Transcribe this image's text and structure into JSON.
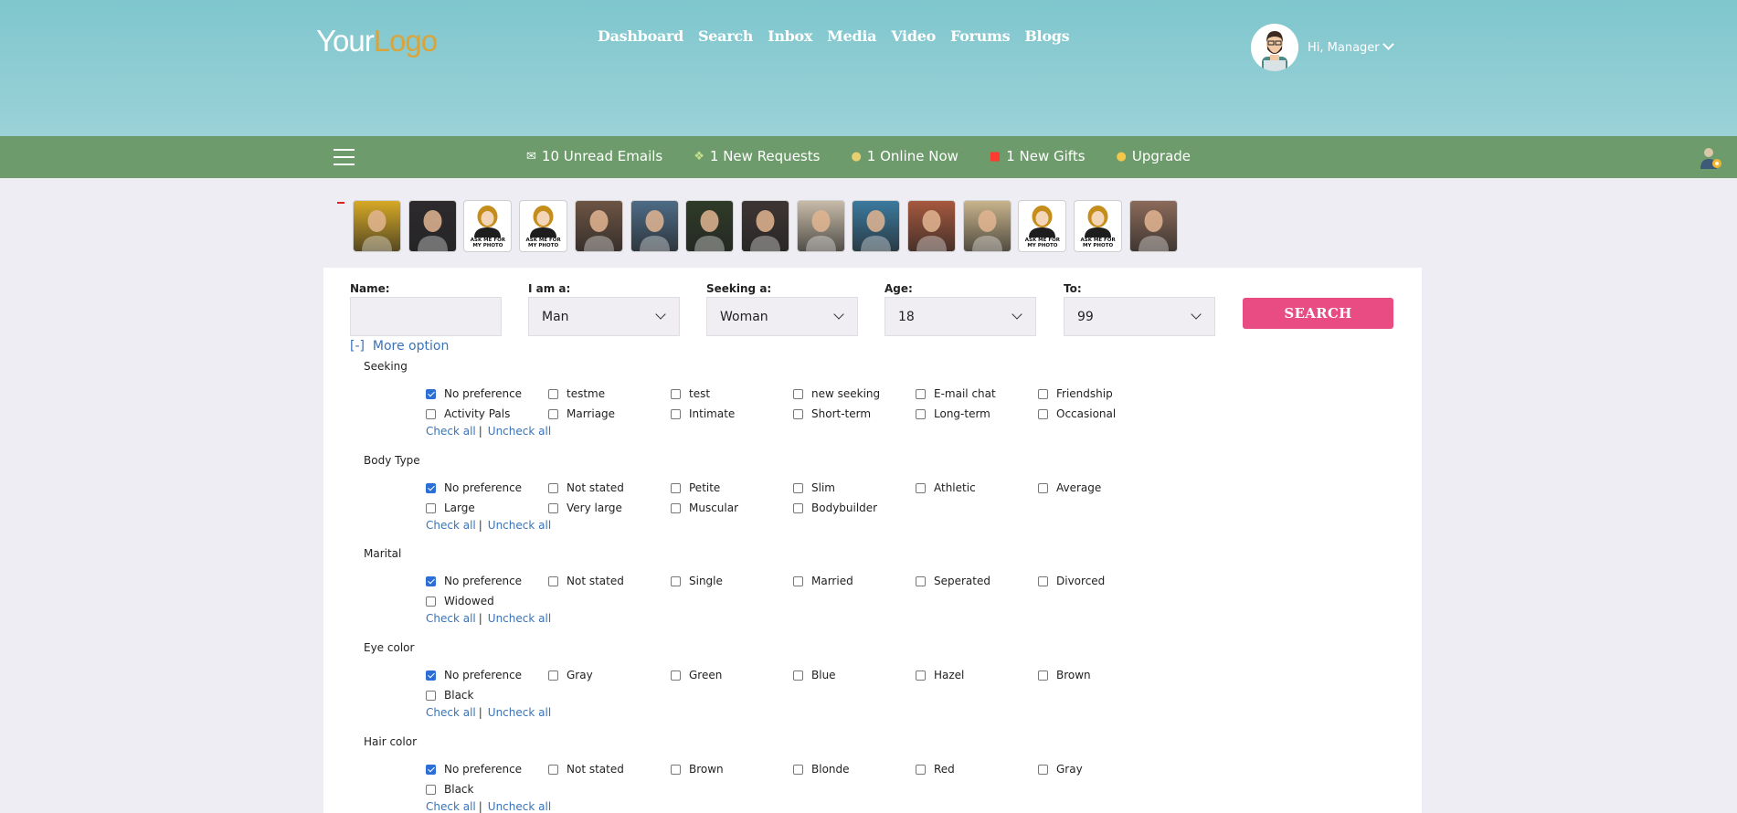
{
  "logo": {
    "part1": "Your",
    "part2": "Logo"
  },
  "nav": [
    "Dashboard",
    "Search",
    "Inbox",
    "Media",
    "Video",
    "Forums",
    "Blogs"
  ],
  "user": {
    "greeting": "Hi, Manager"
  },
  "notifications": [
    {
      "icon": "envelope-icon",
      "label": "10 Unread Emails"
    },
    {
      "icon": "request-icon",
      "label": "1 New Requests"
    },
    {
      "icon": "online-user-icon",
      "label": "1 Online Now"
    },
    {
      "icon": "gift-icon",
      "label": "1 New Gifts"
    },
    {
      "icon": "coins-icon",
      "label": "Upgrade"
    }
  ],
  "thumbnails": [
    {
      "kind": "photo",
      "color": "#d6a925"
    },
    {
      "kind": "photo",
      "color": "#2d2a2e"
    },
    {
      "kind": "placeholder",
      "text": "ASK ME FOR MY PHOTO"
    },
    {
      "kind": "placeholder",
      "text": "ASK ME FOR MY PHOTO"
    },
    {
      "kind": "photo",
      "color": "#6d5444"
    },
    {
      "kind": "photo",
      "color": "#4d6b86"
    },
    {
      "kind": "photo",
      "color": "#2f3b28"
    },
    {
      "kind": "photo",
      "color": "#3d3533"
    },
    {
      "kind": "photo",
      "color": "#c8bca9"
    },
    {
      "kind": "photo",
      "color": "#3b7a9f"
    },
    {
      "kind": "photo",
      "color": "#a5583e"
    },
    {
      "kind": "photo",
      "color": "#c8b48c"
    },
    {
      "kind": "placeholder",
      "text": "ASK ME FOR MY PHOTO"
    },
    {
      "kind": "placeholder",
      "text": "ASK ME FOR MY PHOTO"
    },
    {
      "kind": "photo",
      "color": "#8b6a5a"
    }
  ],
  "search": {
    "name_label": "Name:",
    "name_value": "",
    "iam_label": "I am a:",
    "iam_value": "Man",
    "seeking_label": "Seeking a:",
    "seeking_value": "Woman",
    "age_label": "Age:",
    "age_value": "18",
    "to_label": "To:",
    "to_value": "99",
    "button": "SEARCH",
    "more_toggle": "[-]",
    "more_label": "More option"
  },
  "links": {
    "check_all": "Check all",
    "separator": "|",
    "uncheck_all": "Uncheck all"
  },
  "sections": [
    {
      "title": "Seeking",
      "options": [
        {
          "label": "No preference",
          "checked": true
        },
        {
          "label": "testme",
          "checked": false
        },
        {
          "label": "test",
          "checked": false
        },
        {
          "label": "new seeking",
          "checked": false
        },
        {
          "label": "E-mail chat",
          "checked": false
        },
        {
          "label": "Friendship",
          "checked": false
        },
        {
          "label": "Activity Pals",
          "checked": false
        },
        {
          "label": "Marriage",
          "checked": false
        },
        {
          "label": "Intimate",
          "checked": false
        },
        {
          "label": "Short-term",
          "checked": false
        },
        {
          "label": "Long-term",
          "checked": false
        },
        {
          "label": "Occasional",
          "checked": false
        }
      ]
    },
    {
      "title": "Body Type",
      "options": [
        {
          "label": "No preference",
          "checked": true
        },
        {
          "label": "Not stated",
          "checked": false
        },
        {
          "label": "Petite",
          "checked": false
        },
        {
          "label": "Slim",
          "checked": false
        },
        {
          "label": "Athletic",
          "checked": false
        },
        {
          "label": "Average",
          "checked": false
        },
        {
          "label": "Large",
          "checked": false
        },
        {
          "label": "Very large",
          "checked": false
        },
        {
          "label": "Muscular",
          "checked": false
        },
        {
          "label": "Bodybuilder",
          "checked": false
        }
      ]
    },
    {
      "title": "Marital",
      "options": [
        {
          "label": "No preference",
          "checked": true
        },
        {
          "label": "Not stated",
          "checked": false
        },
        {
          "label": "Single",
          "checked": false
        },
        {
          "label": "Married",
          "checked": false
        },
        {
          "label": "Seperated",
          "checked": false
        },
        {
          "label": "Divorced",
          "checked": false
        },
        {
          "label": "Widowed",
          "checked": false
        }
      ]
    },
    {
      "title": "Eye color",
      "options": [
        {
          "label": "No preference",
          "checked": true
        },
        {
          "label": "Gray",
          "checked": false
        },
        {
          "label": "Green",
          "checked": false
        },
        {
          "label": "Blue",
          "checked": false
        },
        {
          "label": "Hazel",
          "checked": false
        },
        {
          "label": "Brown",
          "checked": false
        },
        {
          "label": "Black",
          "checked": false
        }
      ]
    },
    {
      "title": "Hair color",
      "options": [
        {
          "label": "No preference",
          "checked": true
        },
        {
          "label": "Not stated",
          "checked": false
        },
        {
          "label": "Brown",
          "checked": false
        },
        {
          "label": "Blonde",
          "checked": false
        },
        {
          "label": "Red",
          "checked": false
        },
        {
          "label": "Gray",
          "checked": false
        },
        {
          "label": "Black",
          "checked": false
        }
      ]
    }
  ],
  "colors": {
    "accent": "#e84c83",
    "header": "#8ecdd3",
    "subbar": "#6e9b6b",
    "link": "#3a73b8"
  }
}
